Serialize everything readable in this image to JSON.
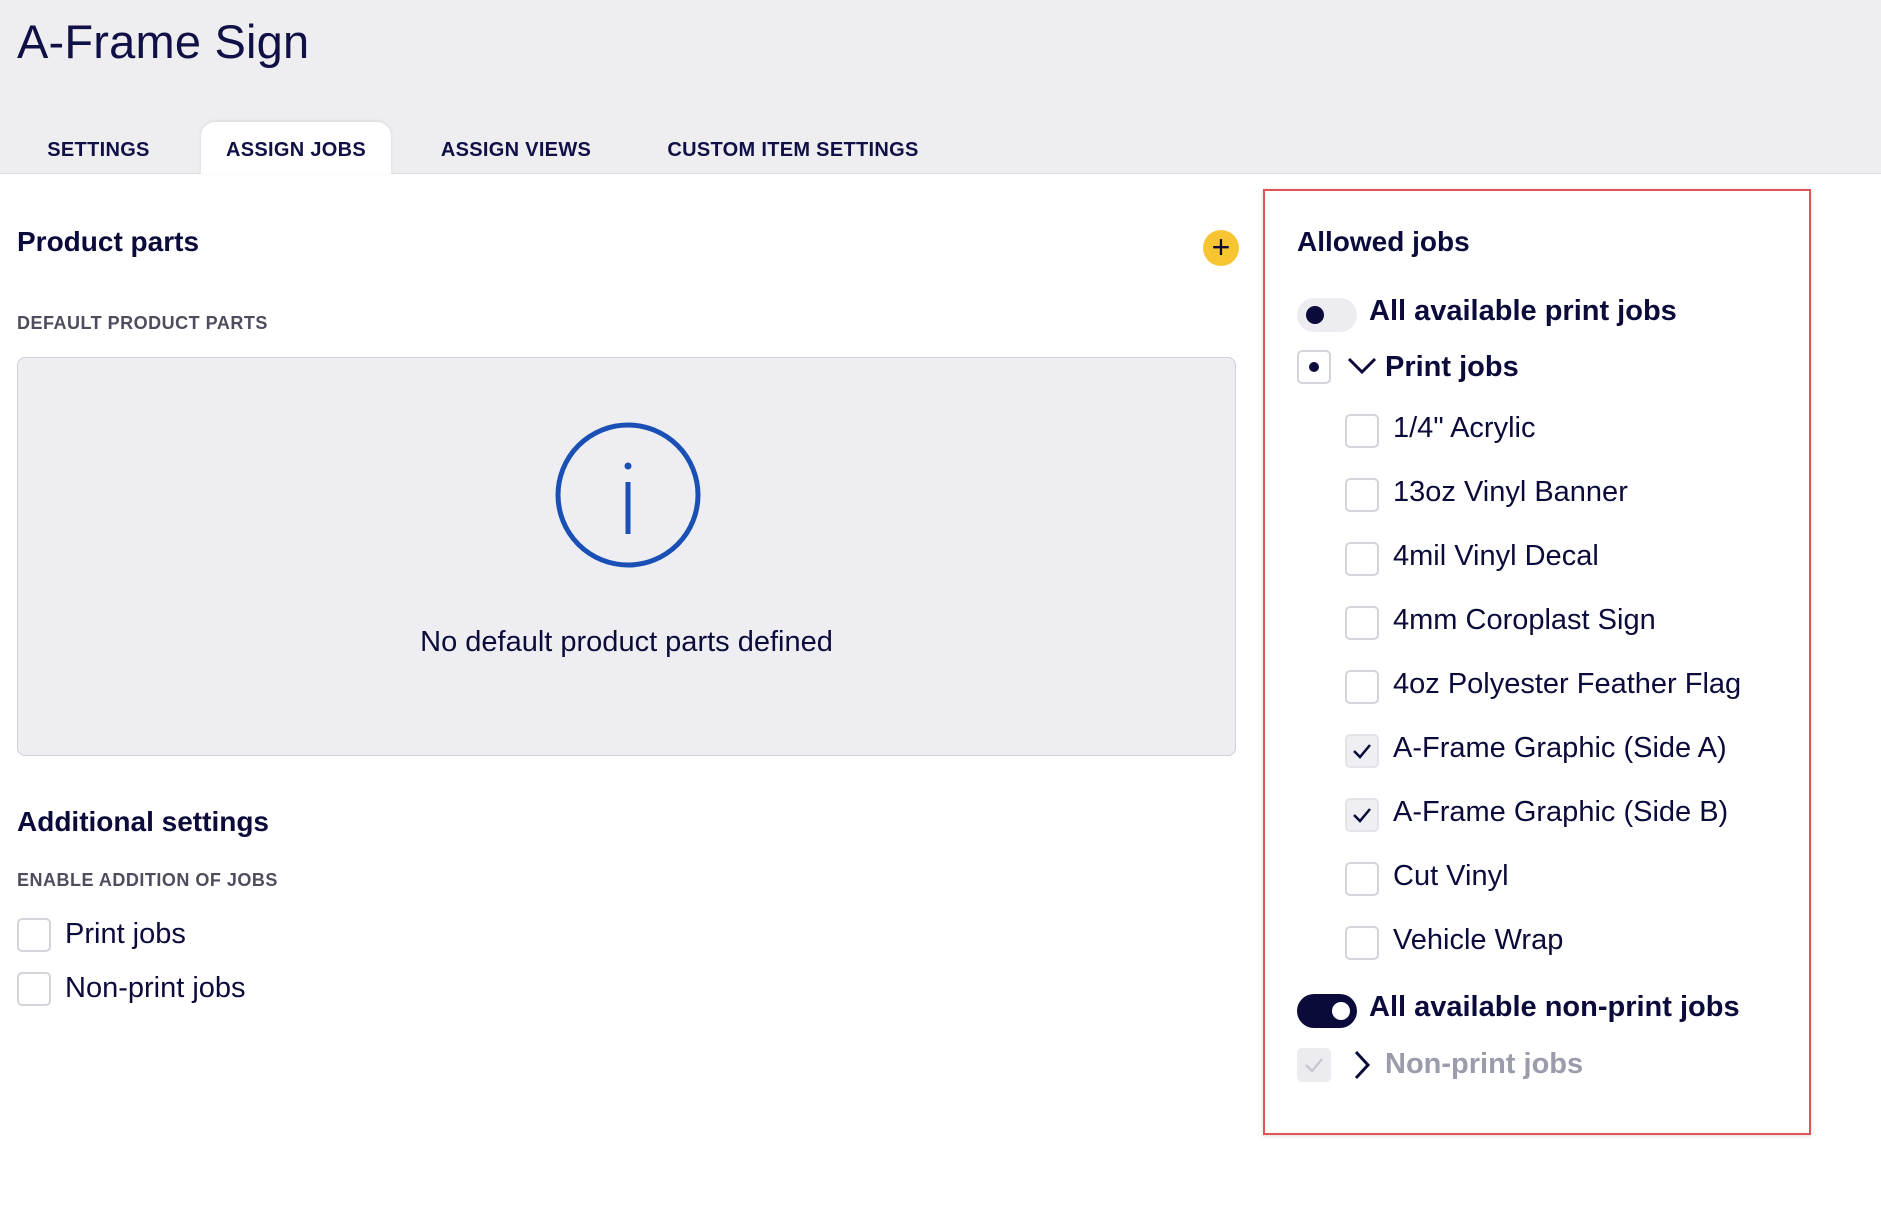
{
  "page": {
    "title": "A-Frame Sign"
  },
  "tabs": [
    {
      "label": "SETTINGS",
      "active": false
    },
    {
      "label": "ASSIGN JOBS",
      "active": true
    },
    {
      "label": "ASSIGN VIEWS",
      "active": false
    },
    {
      "label": "CUSTOM ITEM SETTINGS",
      "active": false
    }
  ],
  "product_parts": {
    "title": "Product parts",
    "add_icon": "plus-icon",
    "default_label": "DEFAULT PRODUCT PARTS",
    "empty_icon": "info-icon",
    "empty_text": "No default product parts defined"
  },
  "additional_settings": {
    "title": "Additional settings",
    "enable_label": "ENABLE ADDITION OF JOBS",
    "options": [
      {
        "label": "Print jobs",
        "checked": false
      },
      {
        "label": "Non-print jobs",
        "checked": false
      }
    ]
  },
  "allowed_jobs": {
    "title": "Allowed jobs",
    "all_print": {
      "label": "All available print jobs",
      "on": false
    },
    "print_group": {
      "label": "Print jobs",
      "state": "indeterminate",
      "expanded": true
    },
    "print_items": [
      {
        "label": "1/4\" Acrylic",
        "checked": false
      },
      {
        "label": "13oz Vinyl Banner",
        "checked": false
      },
      {
        "label": "4mil Vinyl Decal",
        "checked": false
      },
      {
        "label": "4mm Coroplast Sign",
        "checked": false
      },
      {
        "label": "4oz Polyester Feather Flag",
        "checked": false
      },
      {
        "label": "A-Frame Graphic (Side A)",
        "checked": true
      },
      {
        "label": "A-Frame Graphic (Side B)",
        "checked": true
      },
      {
        "label": "Cut Vinyl",
        "checked": false
      },
      {
        "label": "Vehicle Wrap",
        "checked": false
      }
    ],
    "all_nonprint": {
      "label": "All available non-print jobs",
      "on": true
    },
    "nonprint_group": {
      "label": "Non-print jobs",
      "state": "checked-disabled",
      "expanded": false
    }
  },
  "colors": {
    "navy": "#0b0b3b",
    "accent_yellow": "#f6c531",
    "info_blue": "#1a4fb5",
    "highlight_red": "#e25454"
  }
}
